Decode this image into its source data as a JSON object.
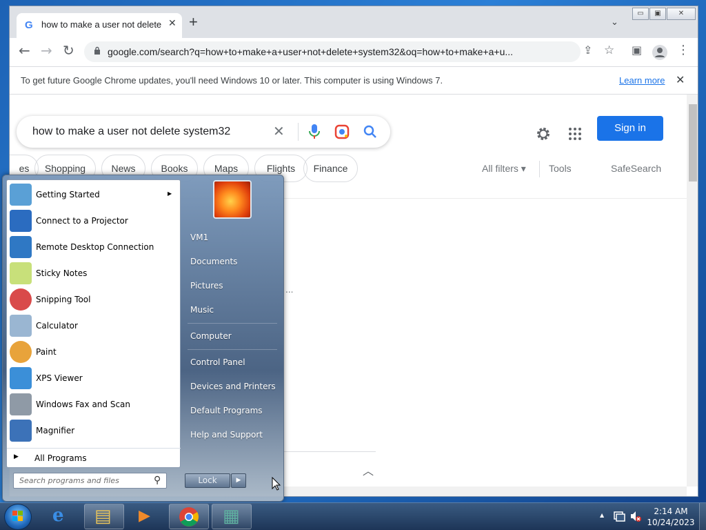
{
  "window": {
    "minimize_glyph": "▭",
    "maximize_glyph": "▣",
    "close_glyph": "✕"
  },
  "tab": {
    "favicon": "G",
    "title": "how to make a user not delete system32",
    "close_glyph": "✕",
    "new_tab_glyph": "+",
    "tab_list_glyph": "⌄"
  },
  "toolbar": {
    "back": "←",
    "forward": "→",
    "reload": "↻",
    "url": "google.com/search?q=how+to+make+a+user+not+delete+system32&oq=how+to+make+a+u...",
    "share": "⇪",
    "bookmark": "☆",
    "side_panel": "▣",
    "menu": "⋮"
  },
  "infobar": {
    "message": "To get future Google Chrome updates, you'll need Windows 10 or later. This computer is using Windows 7.",
    "link": "Learn more",
    "close": "✕"
  },
  "search": {
    "query": "how to make a user not delete system32",
    "clear": "✕",
    "signin": "Sign in"
  },
  "chips": [
    "es",
    "Shopping",
    "News",
    "Books",
    "Maps",
    "Flights",
    "Finance"
  ],
  "tools": {
    "all_filters": "All filters ▾",
    "tools": "Tools",
    "safesearch": "SafeSearch"
  },
  "page": {
    "ellipsis": "...",
    "collapse": "︿"
  },
  "start_menu": {
    "programs": [
      {
        "label": "Getting Started",
        "icon": "getting-started-icon",
        "color": "#5aa0d6",
        "arrow": "▶"
      },
      {
        "label": "Connect to a Projector",
        "icon": "projector-icon",
        "color": "#2b6cc0"
      },
      {
        "label": "Remote Desktop Connection",
        "icon": "remote-desktop-icon",
        "color": "#2f78c4"
      },
      {
        "label": "Sticky Notes",
        "icon": "sticky-notes-icon",
        "color": "#c8e07a"
      },
      {
        "label": "Snipping Tool",
        "icon": "snipping-tool-icon",
        "color": "#d94a4a"
      },
      {
        "label": "Calculator",
        "icon": "calculator-icon",
        "color": "#9ab6d2"
      },
      {
        "label": "Paint",
        "icon": "paint-icon",
        "color": "#e8a33b"
      },
      {
        "label": "XPS Viewer",
        "icon": "xps-viewer-icon",
        "color": "#3b8fd8"
      },
      {
        "label": "Windows Fax and Scan",
        "icon": "fax-scan-icon",
        "color": "#8f9aa6"
      },
      {
        "label": "Magnifier",
        "icon": "magnifier-icon",
        "color": "#3c72b8"
      }
    ],
    "all_programs": "All Programs",
    "all_programs_arrow": "▶",
    "search_placeholder": "Search programs and files",
    "search_icon": "⚲",
    "right_items": [
      {
        "label": "VM1"
      },
      {
        "label": "Documents"
      },
      {
        "label": "Pictures"
      },
      {
        "label": "Music"
      },
      {
        "label": "Computer"
      },
      {
        "label": "Control Panel"
      },
      {
        "label": "Devices and Printers"
      },
      {
        "label": "Default Programs"
      },
      {
        "label": "Help and Support"
      }
    ],
    "lock": "Lock",
    "lock_arrow": "▶"
  },
  "taskbar": {
    "apps": [
      {
        "name": "internet-explorer-icon",
        "glyph": "e",
        "color": "#3a8ee6"
      },
      {
        "name": "file-explorer-icon",
        "glyph": "▤",
        "color": "#e8c35a"
      },
      {
        "name": "media-player-icon",
        "glyph": "▶",
        "color": "#f08a2a"
      },
      {
        "name": "chrome-icon",
        "glyph": "◉",
        "color": "#db4437"
      },
      {
        "name": "installer-icon",
        "glyph": "▦",
        "color": "#5fb0a0"
      }
    ],
    "tray_up": "▲",
    "time": "2:14 AM",
    "date": "10/24/2023"
  }
}
